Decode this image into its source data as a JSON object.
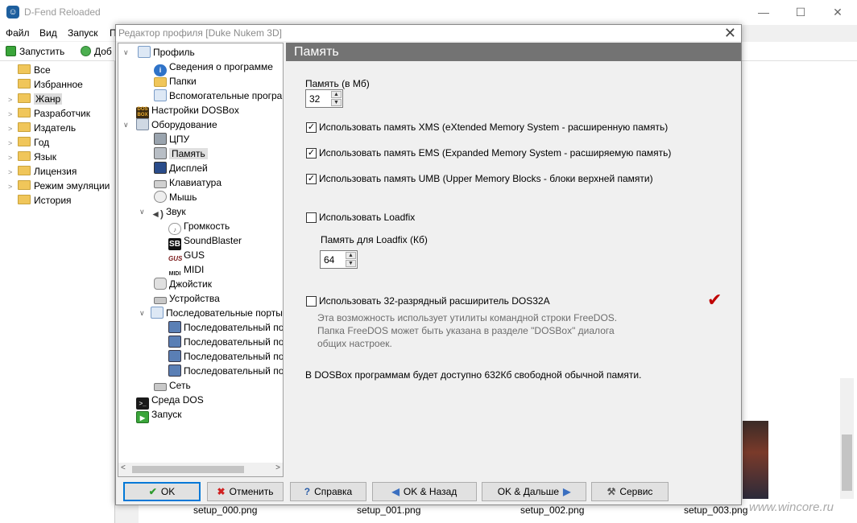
{
  "main_window": {
    "title": "D-Fend Reloaded",
    "app_icon": "ghost-icon",
    "controls": {
      "minimize": "—",
      "maximize": "☐",
      "close": "✕"
    }
  },
  "menubar": {
    "items": [
      "Файл",
      "Вид",
      "Запуск",
      "П"
    ]
  },
  "toolbar": {
    "run_label": "Запустить",
    "add_label": "Доб"
  },
  "left_tree": {
    "items": [
      {
        "label": "Все"
      },
      {
        "label": "Избранное"
      },
      {
        "label": "Жанр"
      },
      {
        "label": "Разработчик"
      },
      {
        "label": "Издатель"
      },
      {
        "label": "Год"
      },
      {
        "label": "Язык"
      },
      {
        "label": "Лицензия"
      },
      {
        "label": "Режим эмуляции"
      },
      {
        "label": "История"
      }
    ]
  },
  "thumbnails": [
    "setup_000.png",
    "setup_001.png",
    "setup_002.png",
    "setup_003.png"
  ],
  "watermark": "www.wincore.ru",
  "dialog": {
    "title": "Редактор профиля [Duke Nukem 3D]",
    "close_glyph": "✕",
    "tree": [
      {
        "label": "Профиль",
        "icon": "profile-icon"
      },
      {
        "label": "Сведения о программе",
        "icon": "info-icon"
      },
      {
        "label": "Папки",
        "icon": "folder-icon"
      },
      {
        "label": "Вспомогательные програ",
        "icon": "helper-programs-icon"
      },
      {
        "label": "Настройки DOSBox",
        "icon": "dosbox-icon"
      },
      {
        "label": "Оборудование",
        "icon": "hardware-icon"
      },
      {
        "label": "ЦПУ",
        "icon": "cpu-icon"
      },
      {
        "label": "Память",
        "icon": "memory-icon"
      },
      {
        "label": "Дисплей",
        "icon": "display-icon"
      },
      {
        "label": "Клавиатура",
        "icon": "keyboard-icon"
      },
      {
        "label": "Мышь",
        "icon": "mouse-icon"
      },
      {
        "label": "Звук",
        "icon": "speaker-icon"
      },
      {
        "label": "Громкость",
        "icon": "volume-icon"
      },
      {
        "label": "SoundBlaster",
        "icon": "soundblaster-icon"
      },
      {
        "label": "GUS",
        "icon": "gus-icon"
      },
      {
        "label": "MIDI",
        "icon": "midi-icon"
      },
      {
        "label": "Джойстик",
        "icon": "joystick-icon"
      },
      {
        "label": "Устройства",
        "icon": "devices-icon"
      },
      {
        "label": "Последовательные порты",
        "icon": "serial-ports-icon"
      },
      {
        "label": "Последовательный по",
        "icon": "serial-port-icon"
      },
      {
        "label": "Последовательный по",
        "icon": "serial-port-icon"
      },
      {
        "label": "Последовательный по",
        "icon": "serial-port-icon"
      },
      {
        "label": "Последовательный по",
        "icon": "serial-port-icon"
      },
      {
        "label": "Сеть",
        "icon": "network-icon"
      },
      {
        "label": "Среда DOS",
        "icon": "dos-environment-icon"
      },
      {
        "label": "Запуск",
        "icon": "run-icon"
      }
    ],
    "panel": {
      "header": "Память",
      "memory_label": "Память (в Мб)",
      "memory_value": "32",
      "xms_label": "Использовать память XMS (eXtended Memory System - расширенную память)",
      "xms_checked": true,
      "ems_label": "Использовать память EMS (Expanded Memory System - расширяемую память)",
      "ems_checked": true,
      "umb_label": "Использовать память UMB (Upper Memory Blocks - блоки верхней памяти)",
      "umb_checked": true,
      "loadfix_label": "Использовать Loadfix",
      "loadfix_checked": false,
      "loadfix_memory_label": "Память для Loadfix (Кб)",
      "loadfix_memory_value": "64",
      "dos32a_label": "Использовать 32-разрядный расширитель DOS32A",
      "dos32a_checked": false,
      "dos32a_note": [
        "Эта возможность использует утилиты командной строки  FreeDOS.",
        "Папка FreeDOS может быть указана в разделе \"DOSBox\" диалога",
        "общих настроек."
      ],
      "free_memory_text": "В DOSBox программам будет доступно 632Кб свободной обычной памяти.",
      "check_mark_color": "#c00000"
    },
    "buttons": {
      "ok": "OK",
      "cancel": "Отменить",
      "help": "Справка",
      "ok_back": "OK & Назад",
      "ok_next": "OK & Дальше",
      "service": "Сервис"
    }
  }
}
